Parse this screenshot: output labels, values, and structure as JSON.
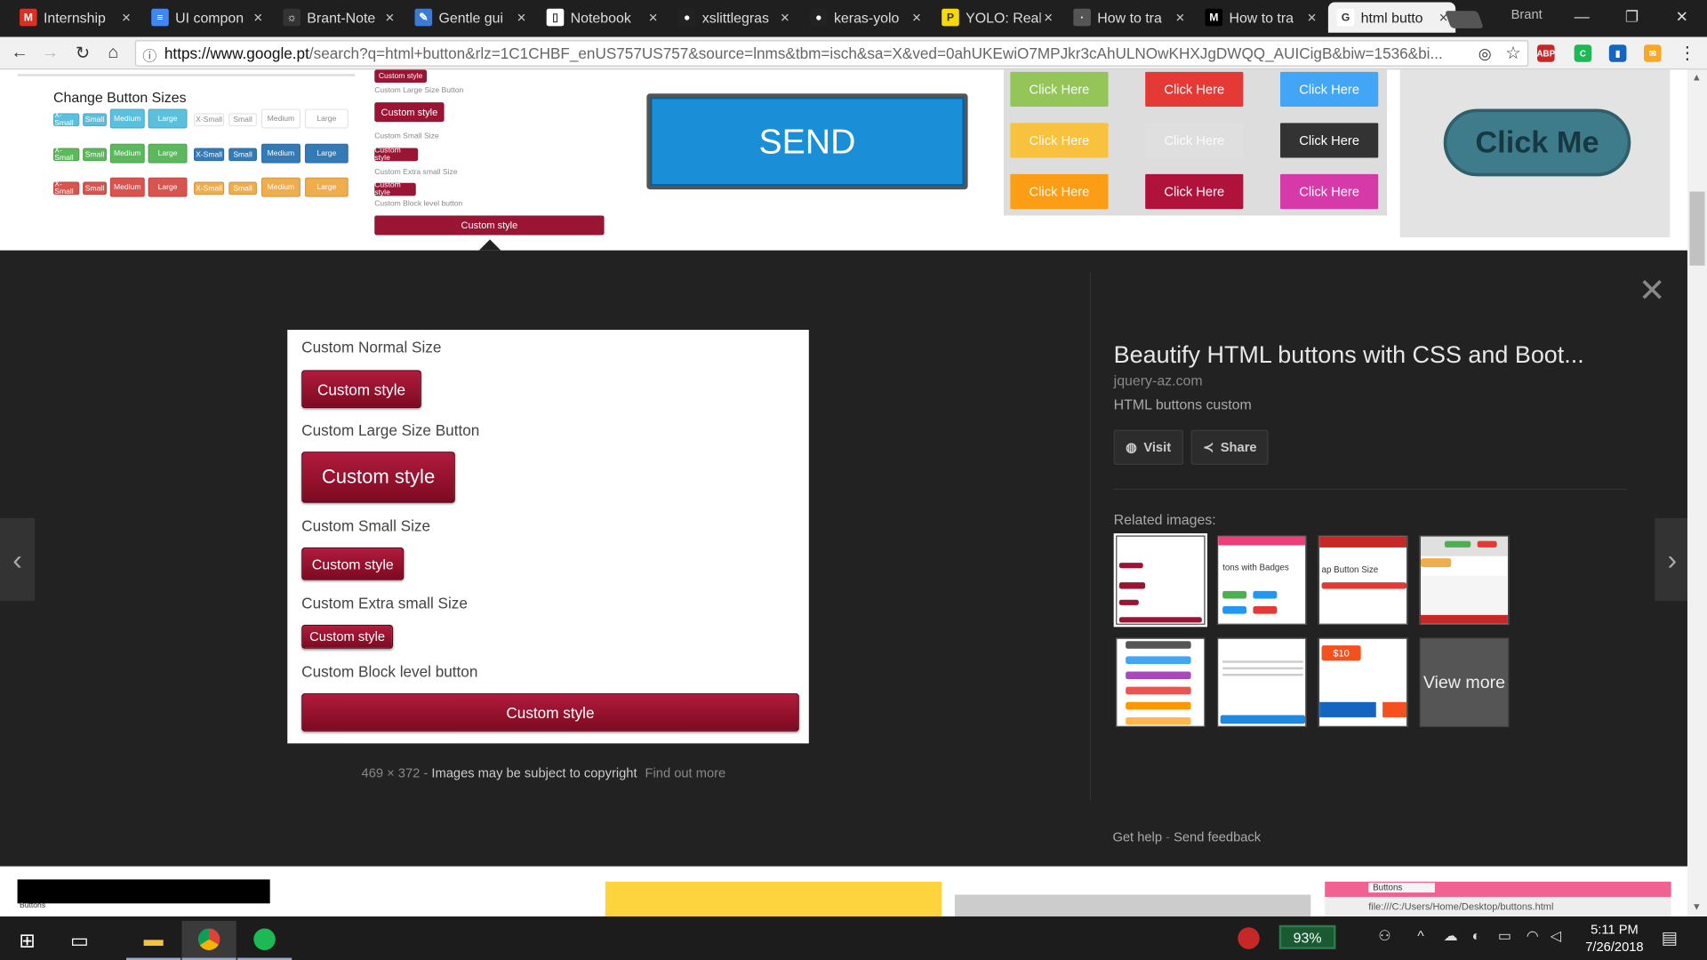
{
  "browser": {
    "tabs": [
      {
        "label": "Internship",
        "icon": "gmail-icon",
        "color": "#d93025",
        "glyph": "M"
      },
      {
        "label": "UI compon",
        "icon": "docs-icon",
        "color": "#4285f4",
        "glyph": "≡"
      },
      {
        "label": "Brant-Note",
        "icon": "bug-icon",
        "color": "#333333",
        "glyph": "☼"
      },
      {
        "label": "Gentle gui",
        "icon": "site-icon",
        "color": "#3a7bd5",
        "glyph": "✎"
      },
      {
        "label": "Notebook",
        "icon": "page-icon",
        "color": "#ffffff",
        "glyph": "▯"
      },
      {
        "label": "xslittlegras",
        "icon": "github-icon",
        "color": "#222222",
        "glyph": "●"
      },
      {
        "label": "keras-yolo",
        "icon": "github-icon",
        "color": "#222222",
        "glyph": "●"
      },
      {
        "label": "YOLO: Real",
        "icon": "pj-icon",
        "color": "#f5d90a",
        "glyph": "P"
      },
      {
        "label": "How to tra",
        "icon": "page-icon",
        "color": "#555555",
        "glyph": "·"
      },
      {
        "label": "How to tra",
        "icon": "medium-icon",
        "color": "#000000",
        "glyph": "M"
      },
      {
        "label": "html butto",
        "icon": "google-icon",
        "color": "#ffffff",
        "glyph": "G"
      }
    ],
    "profile_name": "Brant",
    "url_host": "https://www.google.pt",
    "url_rest": "/search?q=html+button&rlz=1C1CHBF_enUS757US757&source=lnms&tbm=isch&sa=X&ved=0ahUKEwiO7MPJkr3cAhULNOwKHXJgDWQQ_AUICigB&biw=1536&bi...",
    "extensions": [
      "ABP",
      "C",
      "▮",
      "✉"
    ]
  },
  "top_results": {
    "sizes_title": "Change Button Sizes",
    "sizes_rows": [
      {
        "color": "#5bc0de",
        "labels": [
          "X-Small",
          "Small",
          "Medium",
          "Large"
        ]
      },
      {
        "color": "#5cb85c",
        "labels": [
          "X-Small",
          "Small",
          "Medium",
          "Large"
        ]
      },
      {
        "color": "#d9534f",
        "labels": [
          "X-Small",
          "Small",
          "Medium",
          "Large"
        ]
      }
    ],
    "sizes_rows_right": [
      {
        "color": "#ffffff",
        "text_color": "#888888",
        "labels": [
          "X-Small",
          "Small",
          "Medium",
          "Large"
        ]
      },
      {
        "color": "#337ab7",
        "text_color": "#ffffff",
        "labels": [
          "X-Small",
          "Small",
          "Medium",
          "Large"
        ]
      },
      {
        "color": "#f0ad4e",
        "text_color": "#ffffff",
        "labels": [
          "X-Small",
          "Small",
          "Medium",
          "Large"
        ]
      }
    ],
    "custom_small_labels": [
      "Custom style",
      "Custom Large Size Button",
      "Custom style",
      "Custom Small Size",
      "Custom style",
      "Custom Extra small Size",
      "Custom style",
      "Custom Block level button",
      "Custom style"
    ],
    "send_label": "SEND",
    "click_here_label": "Click Here",
    "click_colors": [
      "#8bc34a",
      "#e53935",
      "#42a5f5",
      "#fbc02d",
      "#e0e0e0",
      "#333333",
      "#ff9800",
      "#b0123c",
      "#d63aa8"
    ],
    "click_me_label": "Click Me"
  },
  "preview": {
    "labels": [
      "Custom Normal Size",
      "Custom Large Size Button",
      "Custom Small Size",
      "Custom Extra small Size",
      "Custom Block level button"
    ],
    "button_label": "Custom style",
    "dimensions": "469 × 372",
    "copyright": "Images may be subject to copyright",
    "find_out_more": "Find out more"
  },
  "info": {
    "title": "Beautify HTML buttons with CSS and Boot...",
    "site": "jquery-az.com",
    "description": "HTML buttons custom",
    "visit_label": "Visit",
    "share_label": "Share",
    "related_label": "Related images:",
    "related_texts": [
      "",
      "tons with Badges",
      "ap Button Size",
      "",
      "",
      "",
      "$10",
      "View more"
    ],
    "get_help": "Get help",
    "separator": "-",
    "send_feedback": "Send feedback"
  },
  "bottom": {
    "caption1": "Buttons",
    "tab_caption": "Buttons",
    "path": "file:///C:/Users/Home/Desktop/buttons.html"
  },
  "taskbar": {
    "battery": "93%",
    "time": "5:11 PM",
    "date": "7/26/2018"
  }
}
